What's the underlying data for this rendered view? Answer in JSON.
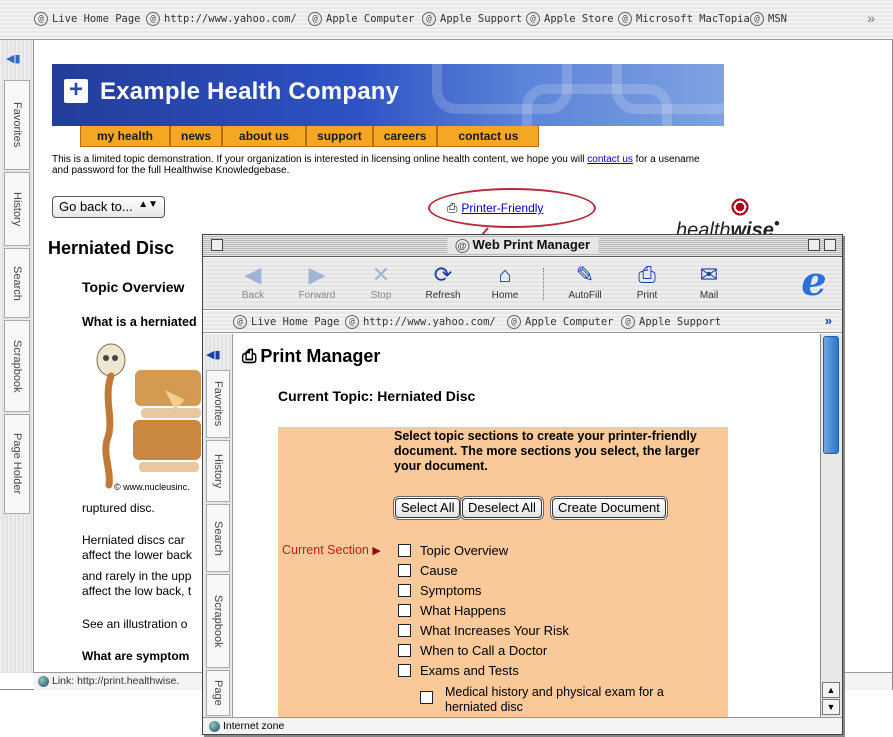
{
  "background_browser": {
    "favorites_bar": [
      "Live Home Page",
      "http://www.yahoo.com/",
      "Apple Computer",
      "Apple Support",
      "Apple Store",
      "Microsoft MacTopia",
      "MSN"
    ],
    "side_tabs": [
      "Favorites",
      "History",
      "Search",
      "Scrapbook",
      "Page Holder"
    ],
    "status_text": "Link: http://print.healthwise."
  },
  "page": {
    "brand": "Example Health Company",
    "nav": [
      "my health",
      "news",
      "about us",
      "support",
      "careers",
      "contact us"
    ],
    "notice_before": "This is a limited topic demonstration. If your organization is interested in licensing online health content, we hope you will ",
    "notice_link": "contact us",
    "notice_after": " for a usename and password for the full Healthwise Knowledgebase.",
    "goback_label": "Go back to...",
    "printer_friendly_link": "Printer-Friendly",
    "healthwise_logo_1": "health",
    "healthwise_logo_2": "wise",
    "heading": "Herniated Disc",
    "topic_overview": "Topic Overview",
    "what_is": "What is a herniated",
    "image_credit": "© www.nucleusinc.",
    "text_ruptured": "ruptured disc.",
    "text_line1": "Herniated discs car",
    "text_line2": "affect the lower back",
    "text_line3": "and rarely in the upp",
    "text_line4": "affect the low back, t",
    "text_see": "See an illustration o",
    "text_symptoms": "What are symptom"
  },
  "print_manager_window": {
    "title": "Web Print Manager",
    "toolbar": [
      {
        "label": "Back",
        "icon": "back-arrow-icon",
        "enabled": false
      },
      {
        "label": "Forward",
        "icon": "forward-arrow-icon",
        "enabled": false
      },
      {
        "label": "Stop",
        "icon": "stop-icon",
        "enabled": false
      },
      {
        "label": "Refresh",
        "icon": "refresh-icon",
        "enabled": true
      },
      {
        "label": "Home",
        "icon": "home-icon",
        "enabled": true
      },
      {
        "label": "AutoFill",
        "icon": "autofill-icon",
        "enabled": true
      },
      {
        "label": "Print",
        "icon": "printer-icon",
        "enabled": true
      },
      {
        "label": "Mail",
        "icon": "mail-icon",
        "enabled": true
      }
    ],
    "favorites_bar": [
      "Live Home Page",
      "http://www.yahoo.com/",
      "Apple Computer",
      "Apple Support"
    ],
    "side_tabs": [
      "Favorites",
      "History",
      "Search",
      "Scrapbook",
      "Page"
    ],
    "heading": "Print Manager",
    "current_topic": "Current Topic: Herniated Disc",
    "instructions": "Select topic sections to create your printer-friendly document. The more sections you select, the larger your document.",
    "buttons": {
      "select_all": "Select All",
      "deselect_all": "Deselect All",
      "create_document": "Create Document"
    },
    "current_section_label": "Current Section",
    "sections": [
      "Topic Overview",
      "Cause",
      "Symptoms",
      "What Happens",
      "What Increases Your Risk",
      "When to Call a Doctor",
      "Exams and Tests"
    ],
    "subsection": "Medical history and physical exam for a herniated disc",
    "status_text": "Internet zone"
  },
  "colors": {
    "banner_blue": "#2e52c4",
    "nav_orange": "#f5a623",
    "panel_peach": "#f9c99a",
    "highlight_red": "#b62a3a",
    "link_blue": "#0000cc"
  }
}
